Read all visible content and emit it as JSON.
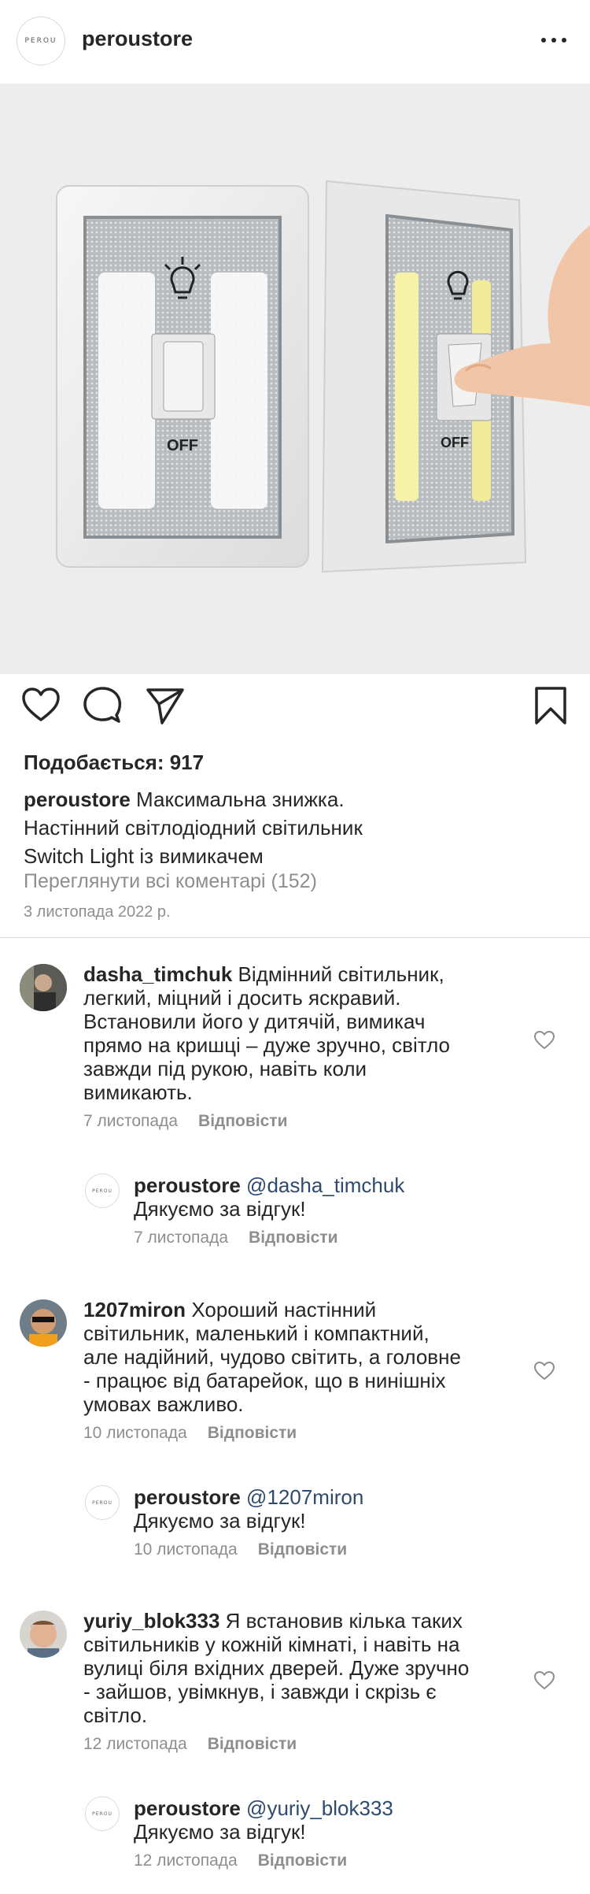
{
  "header": {
    "logo_text": "PEROU",
    "username": "peroustore",
    "more_icon": "more-horizontal-icon"
  },
  "photo": {
    "product_label_left": "OFF",
    "product_label_right": "OFF"
  },
  "actions": {
    "like_icon": "heart-icon",
    "comment_icon": "comment-icon",
    "share_icon": "send-icon",
    "save_icon": "bookmark-icon"
  },
  "post": {
    "likes": "Подобається: 917",
    "caption_user": "peroustore",
    "caption_line1": "Максимальна знижка.",
    "caption_line2": "Настінний світлодіодний світильник",
    "caption_line3": "Switch Light із вимикачем",
    "view_comments": "Переглянути всі коментарі (152)",
    "date": "3 листопада 2022 р."
  },
  "comments": [
    {
      "user": "dasha_timchuk",
      "lines": [
        "Відмінний світильник,",
        "легкий, міцний і досить яскравий.",
        "Встановили його у дитячій, вимикач",
        "прямо на кришці – дуже зручно, світло",
        "завжди під рукою, навіть коли",
        "вимикають."
      ],
      "date": "7 листопада",
      "reply_label": "Відповісти",
      "reply": {
        "user": "peroustore",
        "mention": "@dasha_timchuk",
        "text": "Дякуємо за відгук!",
        "date": "7 листопада",
        "reply_label": "Відповісти"
      }
    },
    {
      "user": "1207miron",
      "lines": [
        "Хороший настінний",
        "світильник, маленький і компактний,",
        "але надійний, чудово світить, а головне",
        "- працює від батарейок, що в нинішніх",
        "умовах важливо."
      ],
      "date": "10 листопада",
      "reply_label": "Відповісти",
      "reply": {
        "user": "peroustore",
        "mention": "@1207miron",
        "text": "Дякуємо за відгук!",
        "date": "10 листопада",
        "reply_label": "Відповісти"
      }
    },
    {
      "user": "yuriy_blok333",
      "lines": [
        "Я встановив кілька таких",
        "світильників у кожній кімнаті, і навіть на",
        "вулиці біля вхідних дверей. Дуже зручно",
        "- зайшов, увімкнув, і завжди і скрізь є",
        "світло."
      ],
      "date": "12 листопада",
      "reply_label": "Відповісти",
      "reply": {
        "user": "peroustore",
        "mention": "@yuriy_blok333",
        "text": "Дякуємо за відгук!",
        "date": "12 листопада",
        "reply_label": "Відповісти"
      }
    }
  ]
}
